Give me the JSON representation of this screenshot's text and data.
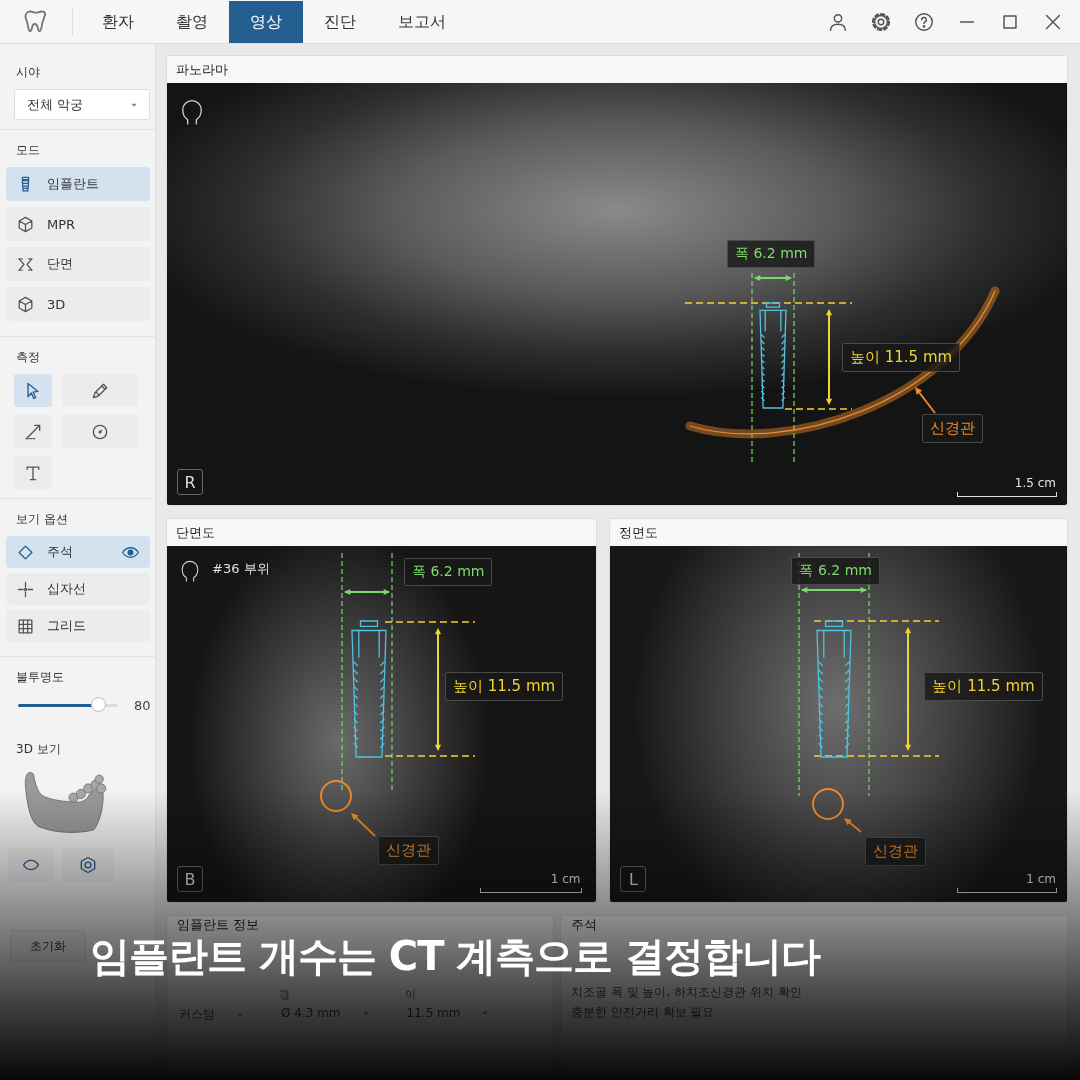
{
  "tabs": [
    {
      "label": "환자",
      "selected": false
    },
    {
      "label": "촬영",
      "selected": false
    },
    {
      "label": "영상",
      "selected": true
    },
    {
      "label": "진단",
      "selected": false
    },
    {
      "label": "보고서",
      "selected": false
    }
  ],
  "sidebar": {
    "view_label": "시야",
    "view_select": {
      "value": "전체 악궁"
    },
    "mode_label": "모드",
    "modes": [
      {
        "label": "임플란트",
        "selected": true
      },
      {
        "label": "MPR",
        "selected": false
      },
      {
        "label": "단면",
        "selected": false
      },
      {
        "label": "3D",
        "selected": false
      }
    ],
    "measure_label": "측정",
    "measure_tools": [
      {
        "selected": true
      },
      {
        "selected": false
      },
      {
        "selected": false
      },
      {
        "selected": false
      },
      {
        "selected": false
      }
    ],
    "view_options_label": "보기 옵션",
    "view_options": [
      {
        "label": "주석",
        "selected": true,
        "visible": true
      },
      {
        "label": "십자선",
        "selected": false,
        "visible": false
      },
      {
        "label": "그리드",
        "selected": false,
        "visible": false
      }
    ],
    "opacity": {
      "label": "불투명도",
      "level": 0.8,
      "reading": "80"
    },
    "view_3d": {
      "label": "3D 보기"
    },
    "reset_button": "초기화"
  },
  "panels": [
    {
      "title": "파노라마",
      "width_label": "폭 6.2 mm",
      "height_label": "높이 11.5 mm",
      "nerve_label": "신경관",
      "orientation": "R",
      "scale": "1.5 cm"
    },
    {
      "title": "단면도",
      "site": "#36 부위",
      "width_label": "폭 6.2 mm",
      "height_label": "높이 11.5 mm",
      "nerve_label": "신경관",
      "orientation": "B",
      "scale": "1 cm"
    },
    {
      "title": "정면도",
      "width_label": "폭 6.2 mm",
      "height_label": "높이 11.5 mm",
      "nerve_label": "신경관",
      "orientation": "L",
      "scale": "1 cm"
    }
  ],
  "implant_info": {
    "title": "임플란트 정보",
    "fields": [
      {
        "value": "커스텀"
      },
      {
        "label": "경",
        "value": "Ø 4.3 mm"
      },
      {
        "label": "이",
        "value": "11.5 mm"
      }
    ]
  },
  "notes": {
    "title": "주석",
    "lines": [
      "치조골 폭 및 높이, 하치조신경관 위치 확인",
      "충분한 안전거리 확보 필요"
    ]
  },
  "caption": "임플란트 개수는 CT 계측으로 결정합니다"
}
